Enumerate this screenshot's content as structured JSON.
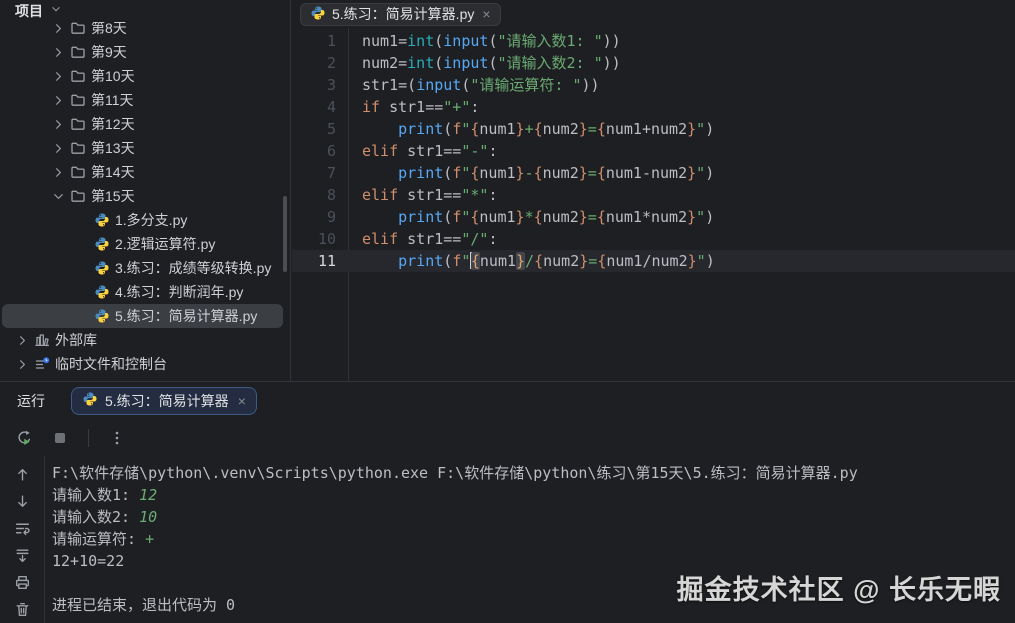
{
  "colors": {
    "background": "#1E1F22",
    "keyword": "#CF8E6D",
    "builtin": "#56A8F5",
    "type": "#2AACB8",
    "string": "#6AAB73",
    "console_input": "#6AAB73",
    "selection_gray": "#3B3E43",
    "run_tab_border": "#3E5B85"
  },
  "project_panel": {
    "header": {
      "title": "项目",
      "chevron_icon": "chevron-down-icon"
    },
    "tree": [
      {
        "label": "第8天",
        "type": "folder",
        "state": "collapsed",
        "partial": true
      },
      {
        "label": "第9天",
        "type": "folder",
        "state": "collapsed"
      },
      {
        "label": "第10天",
        "type": "folder",
        "state": "collapsed"
      },
      {
        "label": "第11天",
        "type": "folder",
        "state": "collapsed"
      },
      {
        "label": "第12天",
        "type": "folder",
        "state": "collapsed"
      },
      {
        "label": "第13天",
        "type": "folder",
        "state": "collapsed"
      },
      {
        "label": "第14天",
        "type": "folder",
        "state": "collapsed"
      },
      {
        "label": "第15天",
        "type": "folder",
        "state": "expanded"
      },
      {
        "label": "1.多分支.py",
        "type": "python-file"
      },
      {
        "label": "2.逻辑运算符.py",
        "type": "python-file"
      },
      {
        "label": "3.练习：成绩等级转换.py",
        "type": "python-file"
      },
      {
        "label": "4.练习：判断润年.py",
        "type": "python-file"
      },
      {
        "label": "5.练习：简易计算器.py",
        "type": "python-file",
        "selected": true
      },
      {
        "label": "外部库",
        "type": "library-root",
        "state": "collapsed"
      },
      {
        "label": "临时文件和控制台",
        "type": "scratches-root",
        "state": "collapsed"
      }
    ]
  },
  "editor": {
    "tab": {
      "label": "5.练习：简易计算器.py",
      "close_label": "×",
      "icon": "python-icon"
    },
    "current_line": 11,
    "lines": [
      {
        "n": 1,
        "segs": [
          [
            "d",
            "num1="
          ],
          [
            "t",
            "int"
          ],
          [
            "d",
            "("
          ],
          [
            "b",
            "input"
          ],
          [
            "d",
            "("
          ],
          [
            "s",
            "\"请输入数1: \""
          ],
          [
            "d",
            "))"
          ]
        ]
      },
      {
        "n": 2,
        "segs": [
          [
            "d",
            "num2="
          ],
          [
            "t",
            "int"
          ],
          [
            "d",
            "("
          ],
          [
            "b",
            "input"
          ],
          [
            "d",
            "("
          ],
          [
            "s",
            "\"请输入数2: \""
          ],
          [
            "d",
            "))"
          ]
        ]
      },
      {
        "n": 3,
        "segs": [
          [
            "d",
            "str1=("
          ],
          [
            "b",
            "input"
          ],
          [
            "d",
            "("
          ],
          [
            "s",
            "\"请输运算符: \""
          ],
          [
            "d",
            "))"
          ]
        ]
      },
      {
        "n": 4,
        "segs": [
          [
            "k",
            "if"
          ],
          [
            "d",
            " str1=="
          ],
          [
            "s",
            "\"+\""
          ],
          [
            "d",
            ":"
          ]
        ]
      },
      {
        "n": 5,
        "segs": [
          [
            "d",
            "    "
          ],
          [
            "b",
            "print"
          ],
          [
            "d",
            "("
          ],
          [
            "k",
            "f"
          ],
          [
            "s",
            "\""
          ],
          [
            "br",
            "{"
          ],
          [
            "d",
            "num1"
          ],
          [
            "br",
            "}"
          ],
          [
            "s",
            "+"
          ],
          [
            "br",
            "{"
          ],
          [
            "d",
            "num2"
          ],
          [
            "br",
            "}"
          ],
          [
            "s",
            "="
          ],
          [
            "br",
            "{"
          ],
          [
            "d",
            "num1+num2"
          ],
          [
            "br",
            "}"
          ],
          [
            "s",
            "\""
          ],
          [
            "d",
            ")"
          ]
        ]
      },
      {
        "n": 6,
        "segs": [
          [
            "k",
            "elif"
          ],
          [
            "d",
            " str1=="
          ],
          [
            "s",
            "\"-\""
          ],
          [
            "d",
            ":"
          ]
        ]
      },
      {
        "n": 7,
        "segs": [
          [
            "d",
            "    "
          ],
          [
            "b",
            "print"
          ],
          [
            "d",
            "("
          ],
          [
            "k",
            "f"
          ],
          [
            "s",
            "\""
          ],
          [
            "br",
            "{"
          ],
          [
            "d",
            "num1"
          ],
          [
            "br",
            "}"
          ],
          [
            "s",
            "-"
          ],
          [
            "br",
            "{"
          ],
          [
            "d",
            "num2"
          ],
          [
            "br",
            "}"
          ],
          [
            "s",
            "="
          ],
          [
            "br",
            "{"
          ],
          [
            "d",
            "num1-num2"
          ],
          [
            "br",
            "}"
          ],
          [
            "s",
            "\""
          ],
          [
            "d",
            ")"
          ]
        ]
      },
      {
        "n": 8,
        "segs": [
          [
            "k",
            "elif"
          ],
          [
            "d",
            " str1=="
          ],
          [
            "s",
            "\"*\""
          ],
          [
            "d",
            ":"
          ]
        ]
      },
      {
        "n": 9,
        "segs": [
          [
            "d",
            "    "
          ],
          [
            "b",
            "print"
          ],
          [
            "d",
            "("
          ],
          [
            "k",
            "f"
          ],
          [
            "s",
            "\""
          ],
          [
            "br",
            "{"
          ],
          [
            "d",
            "num1"
          ],
          [
            "br",
            "}"
          ],
          [
            "s",
            "*"
          ],
          [
            "br",
            "{"
          ],
          [
            "d",
            "num2"
          ],
          [
            "br",
            "}"
          ],
          [
            "s",
            "="
          ],
          [
            "br",
            "{"
          ],
          [
            "d",
            "num1*num2"
          ],
          [
            "br",
            "}"
          ],
          [
            "s",
            "\""
          ],
          [
            "d",
            ")"
          ]
        ]
      },
      {
        "n": 10,
        "segs": [
          [
            "k",
            "elif"
          ],
          [
            "d",
            " str1=="
          ],
          [
            "s",
            "\"/\""
          ],
          [
            "d",
            ":"
          ]
        ]
      },
      {
        "n": 11,
        "segs": [
          [
            "d",
            "    "
          ],
          [
            "b",
            "print"
          ],
          [
            "d",
            "("
          ],
          [
            "k",
            "f"
          ],
          [
            "s",
            "\""
          ],
          [
            "caret",
            ""
          ],
          [
            "brh",
            "{"
          ],
          [
            "d",
            "num1"
          ],
          [
            "brh",
            "}"
          ],
          [
            "s",
            "/"
          ],
          [
            "br",
            "{"
          ],
          [
            "d",
            "num2"
          ],
          [
            "br",
            "}"
          ],
          [
            "s",
            "="
          ],
          [
            "br",
            "{"
          ],
          [
            "d",
            "num1/num2"
          ],
          [
            "br",
            "}"
          ],
          [
            "s",
            "\""
          ],
          [
            "d",
            ")"
          ]
        ]
      }
    ]
  },
  "run_panel": {
    "title": "运行",
    "tab": {
      "label": "5.练习：简易计算器",
      "close_label": "×",
      "icon": "python-icon"
    },
    "toolbar_icons": [
      {
        "name": "rerun-icon"
      },
      {
        "name": "stop-icon"
      },
      {
        "name": "separator"
      },
      {
        "name": "more-options-icon"
      }
    ],
    "console_strip_icons": [
      {
        "name": "arrow-up-icon"
      },
      {
        "name": "arrow-down-icon"
      },
      {
        "name": "soft-wrap-icon"
      },
      {
        "name": "scroll-to-end-icon"
      },
      {
        "name": "print-icon"
      },
      {
        "name": "clear-console-icon"
      }
    ],
    "console": {
      "lines": [
        {
          "segs": [
            [
              "d",
              "F:\\软件存储\\python\\.venv\\Scripts\\python.exe F:\\软件存储\\python\\练习\\第15天\\5.练习：简易计算器.py"
            ]
          ]
        },
        {
          "segs": [
            [
              "d",
              "请输入数1: "
            ],
            [
              "in",
              "12"
            ]
          ]
        },
        {
          "segs": [
            [
              "d",
              "请输入数2: "
            ],
            [
              "in",
              "10"
            ]
          ]
        },
        {
          "segs": [
            [
              "d",
              "请输运算符: "
            ],
            [
              "in",
              "+"
            ]
          ]
        },
        {
          "segs": [
            [
              "d",
              "12+10=22"
            ]
          ]
        },
        {
          "segs": [
            [
              "d",
              ""
            ]
          ]
        },
        {
          "segs": [
            [
              "d",
              "进程已结束，退出代码为 0"
            ]
          ]
        }
      ]
    }
  },
  "watermark": {
    "text": "掘金技术社区 @ 长乐无暇"
  }
}
